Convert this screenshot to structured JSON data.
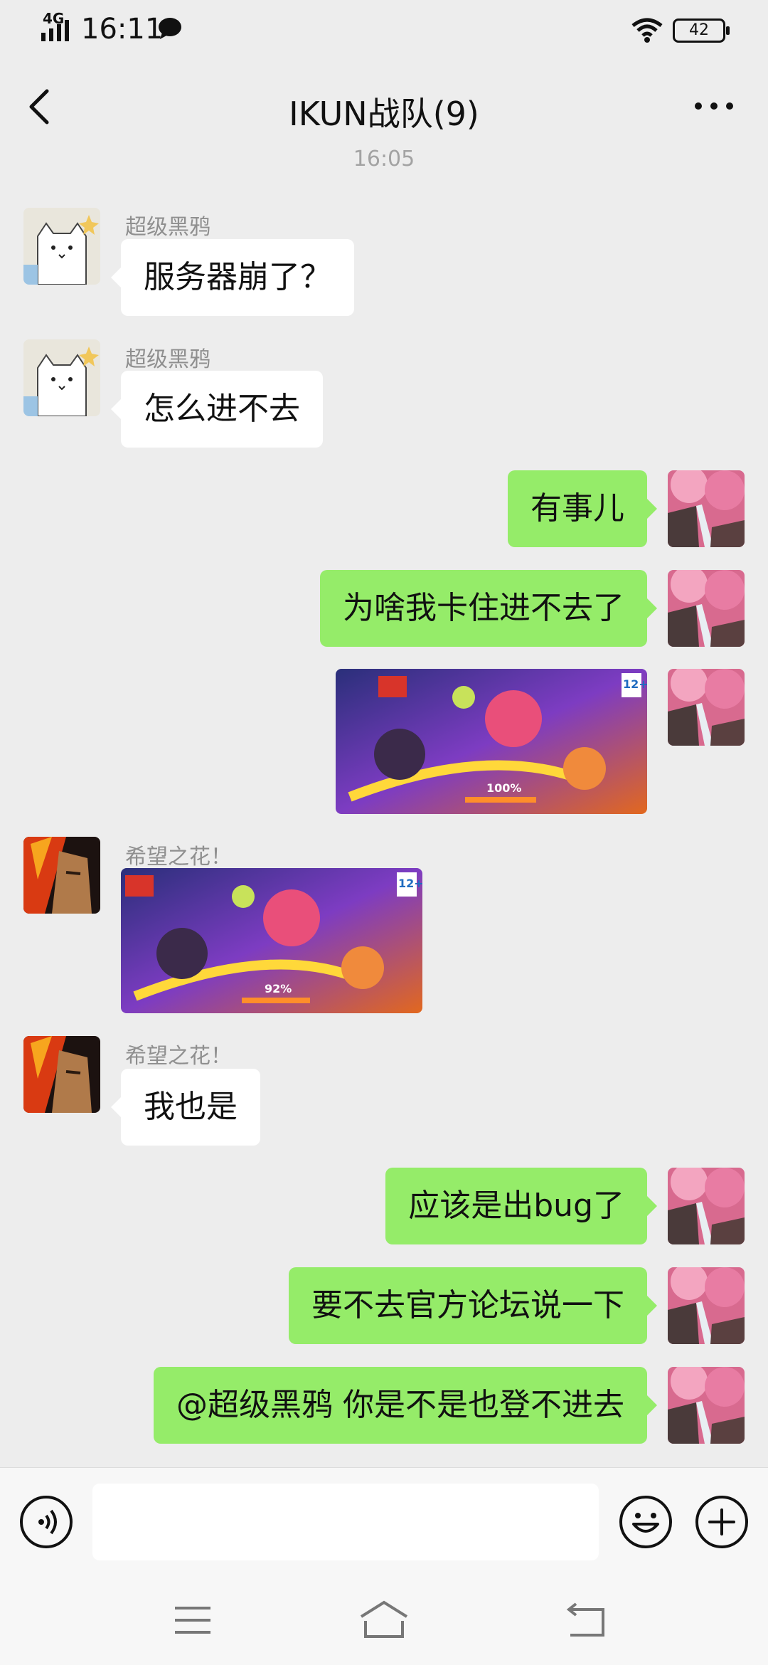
{
  "status_bar": {
    "network": "4G",
    "time": "16:11",
    "battery": "42"
  },
  "nav": {
    "title": "IKUN战队(9)"
  },
  "chat": {
    "timestamp": "16:05",
    "messages": [
      {
        "side": "in",
        "sender": "超级黑鸦",
        "text": "服务器崩了？"
      },
      {
        "side": "in",
        "sender": "超级黑鸦",
        "text": "怎么进不去"
      },
      {
        "side": "out",
        "text": "有事儿"
      },
      {
        "side": "out",
        "text": "为啥我卡住进不去了"
      },
      {
        "side": "out",
        "type": "image",
        "progress_text": "100%",
        "rating": "12+",
        "progress": 1.0
      },
      {
        "side": "in",
        "sender": "希望之花！",
        "type": "image",
        "progress_text": "92%",
        "rating": "12+",
        "progress": 0.92
      },
      {
        "side": "in",
        "sender": "希望之花！",
        "text": "我也是"
      },
      {
        "side": "out",
        "text": "应该是出bug了"
      },
      {
        "side": "out",
        "text": "要不去官方论坛说一下"
      },
      {
        "side": "out",
        "text": "@超级黑鸦  你是不是也登不进去"
      }
    ]
  },
  "input": {
    "placeholder": ""
  },
  "colors": {
    "background": "#ededed",
    "bubble_out": "#95ec69",
    "bubble_in": "#ffffff"
  }
}
